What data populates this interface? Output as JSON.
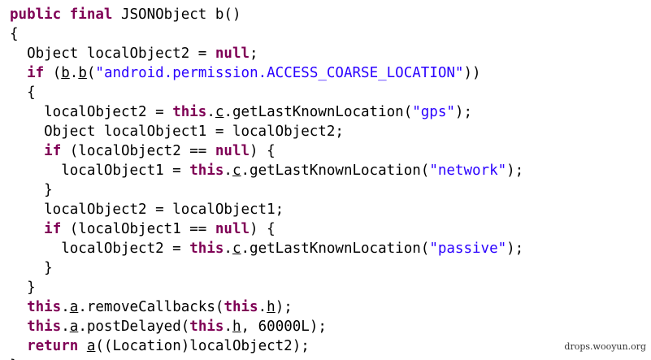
{
  "code": {
    "lines": [
      [
        {
          "t": "public",
          "c": "kw"
        },
        {
          "t": " "
        },
        {
          "t": "final",
          "c": "kw"
        },
        {
          "t": " JSONObject b()"
        }
      ],
      [
        {
          "t": "{"
        }
      ],
      [
        {
          "t": "  Object localObject2 = "
        },
        {
          "t": "null",
          "c": "kw"
        },
        {
          "t": ";"
        }
      ],
      [
        {
          "t": "  "
        },
        {
          "t": "if",
          "c": "kw"
        },
        {
          "t": " ("
        },
        {
          "t": "b",
          "c": "ul"
        },
        {
          "t": "."
        },
        {
          "t": "b",
          "c": "ul"
        },
        {
          "t": "("
        },
        {
          "t": "\"android.permission.ACCESS_COARSE_LOCATION\"",
          "c": "str"
        },
        {
          "t": "))"
        }
      ],
      [
        {
          "t": "  {"
        }
      ],
      [
        {
          "t": "    localObject2 = "
        },
        {
          "t": "this",
          "c": "kw"
        },
        {
          "t": "."
        },
        {
          "t": "c",
          "c": "ul"
        },
        {
          "t": ".getLastKnownLocation("
        },
        {
          "t": "\"gps\"",
          "c": "str"
        },
        {
          "t": ");"
        }
      ],
      [
        {
          "t": "    Object localObject1 = localObject2;"
        }
      ],
      [
        {
          "t": "    "
        },
        {
          "t": "if",
          "c": "kw"
        },
        {
          "t": " (localObject2 == "
        },
        {
          "t": "null",
          "c": "kw"
        },
        {
          "t": ") {"
        }
      ],
      [
        {
          "t": "      localObject1 = "
        },
        {
          "t": "this",
          "c": "kw"
        },
        {
          "t": "."
        },
        {
          "t": "c",
          "c": "ul"
        },
        {
          "t": ".getLastKnownLocation("
        },
        {
          "t": "\"network\"",
          "c": "str"
        },
        {
          "t": ");"
        }
      ],
      [
        {
          "t": "    }"
        }
      ],
      [
        {
          "t": "    localObject2 = localObject1;"
        }
      ],
      [
        {
          "t": "    "
        },
        {
          "t": "if",
          "c": "kw"
        },
        {
          "t": " (localObject1 == "
        },
        {
          "t": "null",
          "c": "kw"
        },
        {
          "t": ") {"
        }
      ],
      [
        {
          "t": "      localObject2 = "
        },
        {
          "t": "this",
          "c": "kw"
        },
        {
          "t": "."
        },
        {
          "t": "c",
          "c": "ul"
        },
        {
          "t": ".getLastKnownLocation("
        },
        {
          "t": "\"passive\"",
          "c": "str"
        },
        {
          "t": ");"
        }
      ],
      [
        {
          "t": "    }"
        }
      ],
      [
        {
          "t": "  }"
        }
      ],
      [
        {
          "t": "  "
        },
        {
          "t": "this",
          "c": "kw"
        },
        {
          "t": "."
        },
        {
          "t": "a",
          "c": "ul"
        },
        {
          "t": ".removeCallbacks("
        },
        {
          "t": "this",
          "c": "kw"
        },
        {
          "t": "."
        },
        {
          "t": "h",
          "c": "ul"
        },
        {
          "t": ");"
        }
      ],
      [
        {
          "t": "  "
        },
        {
          "t": "this",
          "c": "kw"
        },
        {
          "t": "."
        },
        {
          "t": "a",
          "c": "ul"
        },
        {
          "t": ".postDelayed("
        },
        {
          "t": "this",
          "c": "kw"
        },
        {
          "t": "."
        },
        {
          "t": "h",
          "c": "ul"
        },
        {
          "t": ", 60000L);"
        }
      ],
      [
        {
          "t": "  "
        },
        {
          "t": "return",
          "c": "kw"
        },
        {
          "t": " "
        },
        {
          "t": "a",
          "c": "ul"
        },
        {
          "t": "((Location)localObject2);"
        }
      ],
      [
        {
          "t": "}"
        }
      ]
    ]
  },
  "watermark": "drops.wooyun.org",
  "colors": {
    "keyword": "#7f0055",
    "string": "#2a00ff",
    "text": "#000000",
    "background": "#ffffff"
  }
}
